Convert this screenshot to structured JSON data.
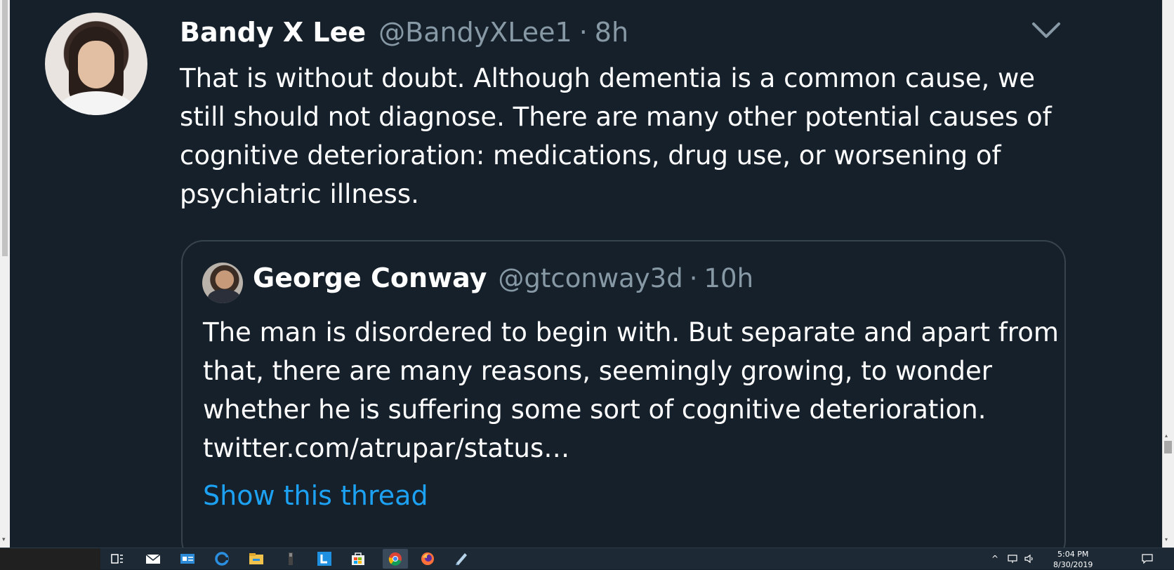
{
  "tweet": {
    "author": {
      "name": "Bandy X Lee",
      "handle": "@BandyXLee1",
      "separator": "·",
      "time": "8h"
    },
    "text_lines": [
      "That is without doubt.  Although dementia is a common cause, we",
      "still should not diagnose.  There are many other potential causes of",
      "cognitive deterioration: medications, drug use, or worsening of",
      "psychiatric illness."
    ],
    "more_menu_icon": "chevron-down-icon"
  },
  "quoted_tweet": {
    "author": {
      "name": "George Conway",
      "handle": "@gtconway3d",
      "separator": "·",
      "time": "10h"
    },
    "text_lines": [
      "The man is disordered to begin with. But separate and apart from",
      "that, there are many reasons, seemingly growing, to wonder",
      "whether he is suffering some sort of cognitive deterioration.",
      "twitter.com/atrupar/status…"
    ],
    "show_thread_label": "Show this thread"
  },
  "taskbar": {
    "icons": [
      "task-view-icon",
      "mail-icon",
      "contacts-icon",
      "edge-icon",
      "file-explorer-icon",
      "app-icon",
      "lync-icon",
      "store-icon",
      "chrome-icon",
      "firefox-icon",
      "notes-icon"
    ],
    "clock_time": "5:04 PM",
    "clock_date": "8/30/2019",
    "tray_icons": [
      "chevron-up-icon",
      "network-icon",
      "volume-icon",
      "notification-icon"
    ]
  },
  "colors": {
    "background": "#15202b",
    "text": "#ffffff",
    "secondary": "#8899a6",
    "link": "#1da1f2",
    "border": "#38444d"
  }
}
